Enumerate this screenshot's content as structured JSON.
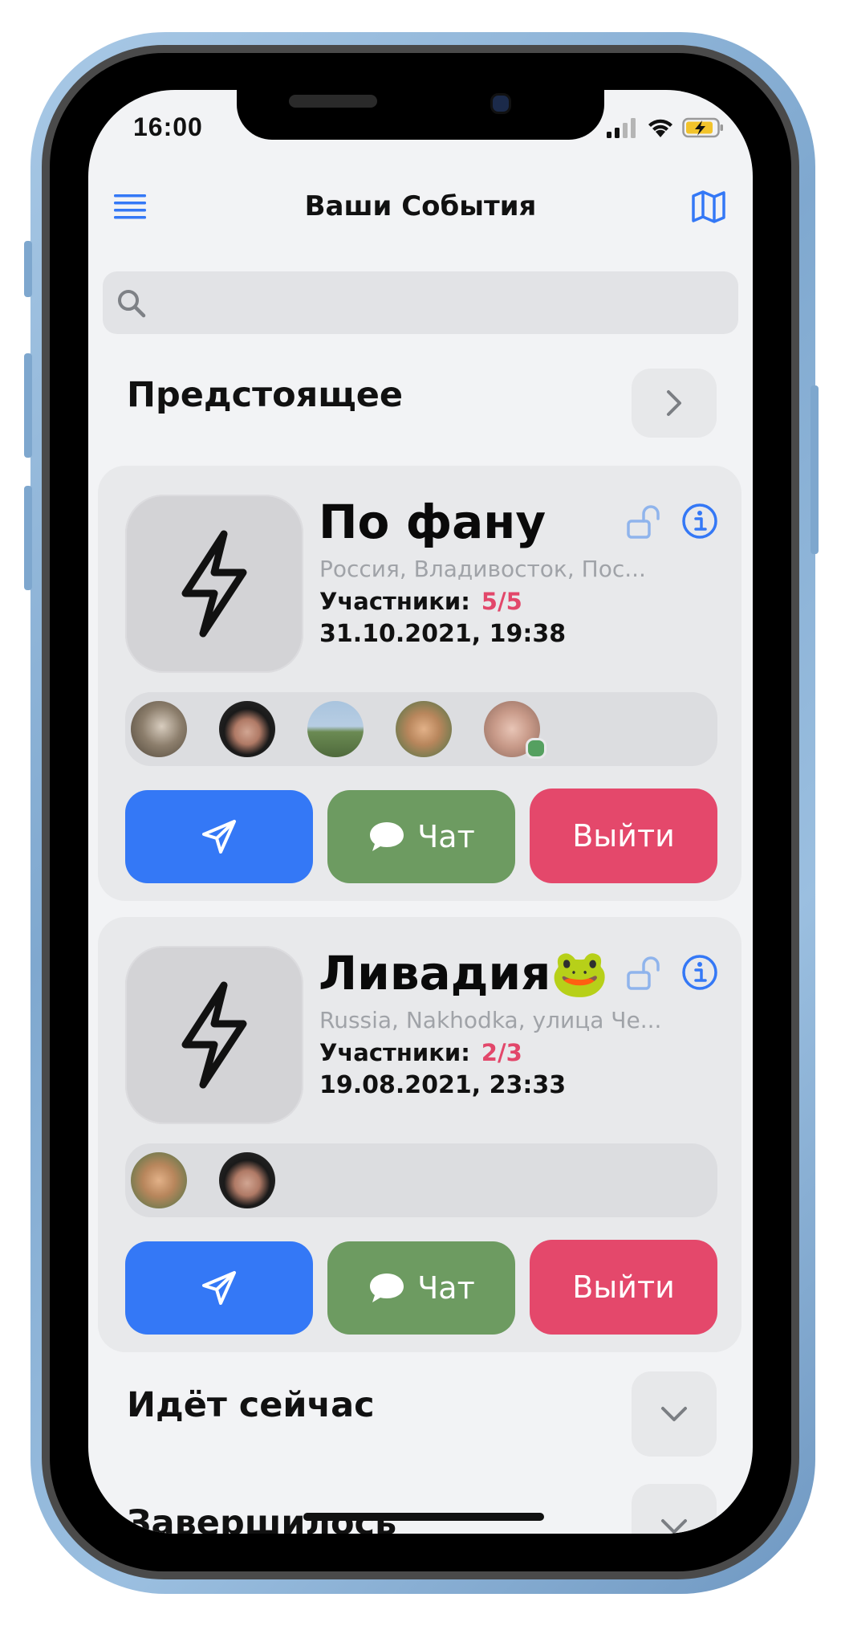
{
  "status_bar": {
    "time": "16:00"
  },
  "nav": {
    "title": "Ваши События",
    "menu_icon": "menu-icon",
    "map_icon": "map-icon"
  },
  "search": {
    "placeholder": "",
    "icon": "search-icon"
  },
  "sections": {
    "upcoming": {
      "title": "Предстоящее",
      "toggle_icon": "chevron-right-icon"
    },
    "ongoing": {
      "title": "Идёт сейчас",
      "toggle_icon": "chevron-down-icon"
    },
    "finished": {
      "title": "Завершилось",
      "toggle_icon": "chevron-down-icon"
    }
  },
  "events": [
    {
      "title": "По фану",
      "address": "Россия, Владивосток, Пос...",
      "participants_label": "Участники:",
      "participants_count": "5/5",
      "datetime": "31.10.2021, 19:38",
      "icon": "lightning-icon",
      "avatars": [
        "avatar-1",
        "avatar-2",
        "avatar-3",
        "avatar-4",
        "avatar-5"
      ],
      "online_avatar_index": 4,
      "buttons": {
        "chat": "Чат",
        "exit": "Выйти"
      }
    },
    {
      "title": "Ливадия🐸",
      "address": "Russia, Nakhodka, улица Че...",
      "participants_label": "Участники:",
      "participants_count": "2/3",
      "datetime": "19.08.2021, 23:33",
      "icon": "lightning-icon",
      "avatars": [
        "avatar-4",
        "avatar-2"
      ],
      "buttons": {
        "chat": "Чат",
        "exit": "Выйти"
      }
    }
  ],
  "colors": {
    "accent_blue": "#3478f6",
    "chat_green": "#6d9b61",
    "exit_red": "#e4486b",
    "participants_red": "#e2476a"
  }
}
